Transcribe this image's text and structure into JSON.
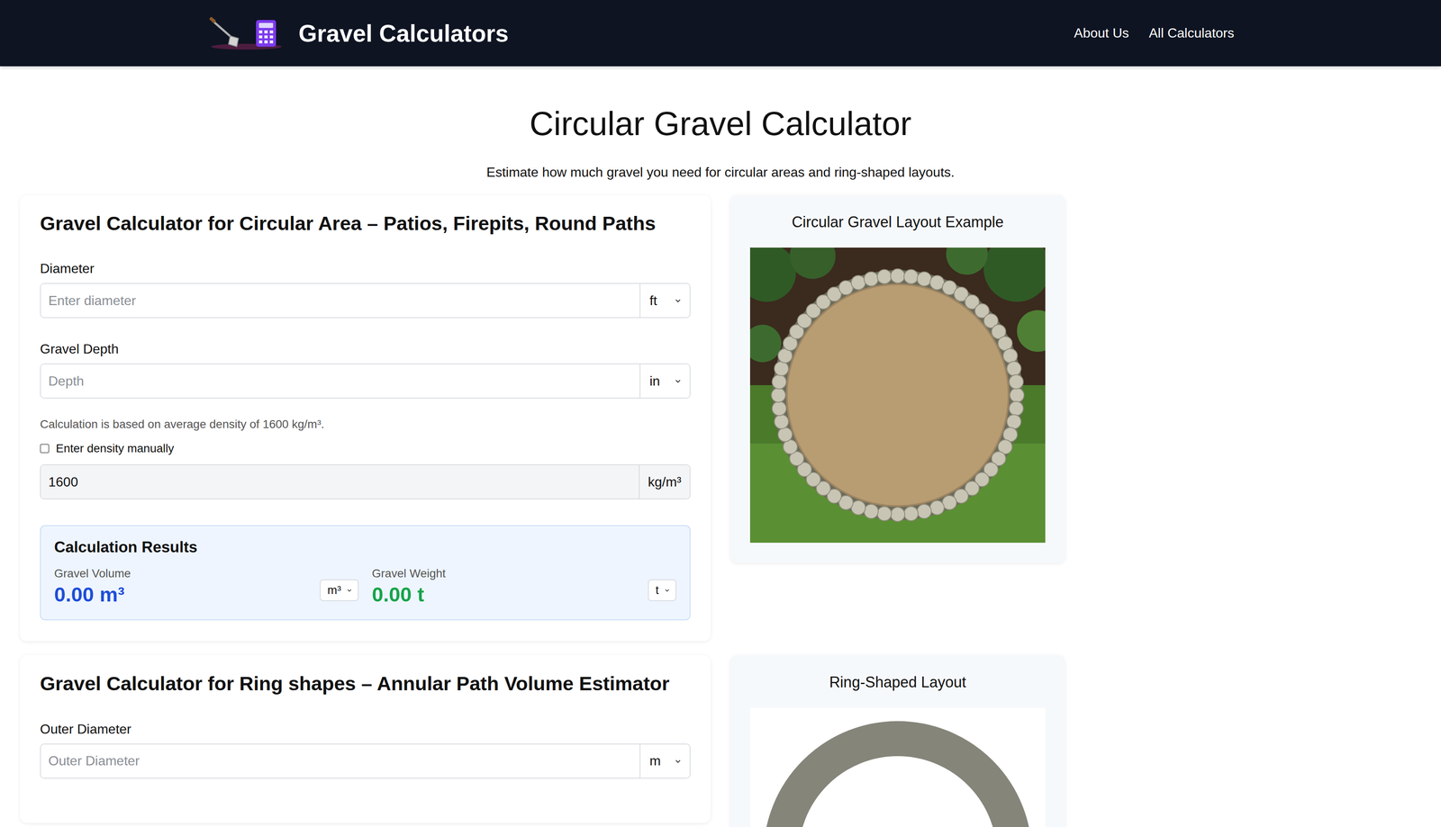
{
  "header": {
    "title": "Gravel Calculators",
    "nav": [
      "About Us",
      "All Calculators"
    ]
  },
  "page": {
    "title": "Circular Gravel Calculator",
    "subtitle": "Estimate how much gravel you need for circular areas and ring-shaped layouts."
  },
  "circular": {
    "heading": "Gravel Calculator for Circular Area – Patios, Firepits, Round Paths",
    "fields": [
      {
        "label": "Diameter",
        "placeholder": "Enter diameter",
        "unit": "ft"
      },
      {
        "label": "Gravel Depth",
        "placeholder": "Depth",
        "unit": "in"
      }
    ],
    "density_note": "Calculation is based on average density of 1600 kg/m³.",
    "manual_density": {
      "label": "Enter density manually",
      "checked": false
    },
    "density": {
      "value": "1600",
      "unit": "kg/m³",
      "disabled": true
    },
    "results": {
      "title": "Calculation Results",
      "items": [
        {
          "label": "Gravel Volume",
          "value": "0.00 m³",
          "unit": "m³",
          "color": "#1d4ed8"
        },
        {
          "label": "Gravel Weight",
          "value": "0.00 t",
          "unit": "t",
          "color": "#16a34a"
        }
      ]
    }
  },
  "circular_image": {
    "title": "Circular Gravel Layout Example"
  },
  "ring": {
    "heading": "Gravel Calculator for Ring shapes – Annular Path Volume Estimator",
    "fields": [
      {
        "label": "Outer Diameter",
        "placeholder": "Outer Diameter",
        "unit": "m"
      }
    ]
  },
  "ring_image": {
    "title": "Ring-Shaped Layout"
  }
}
